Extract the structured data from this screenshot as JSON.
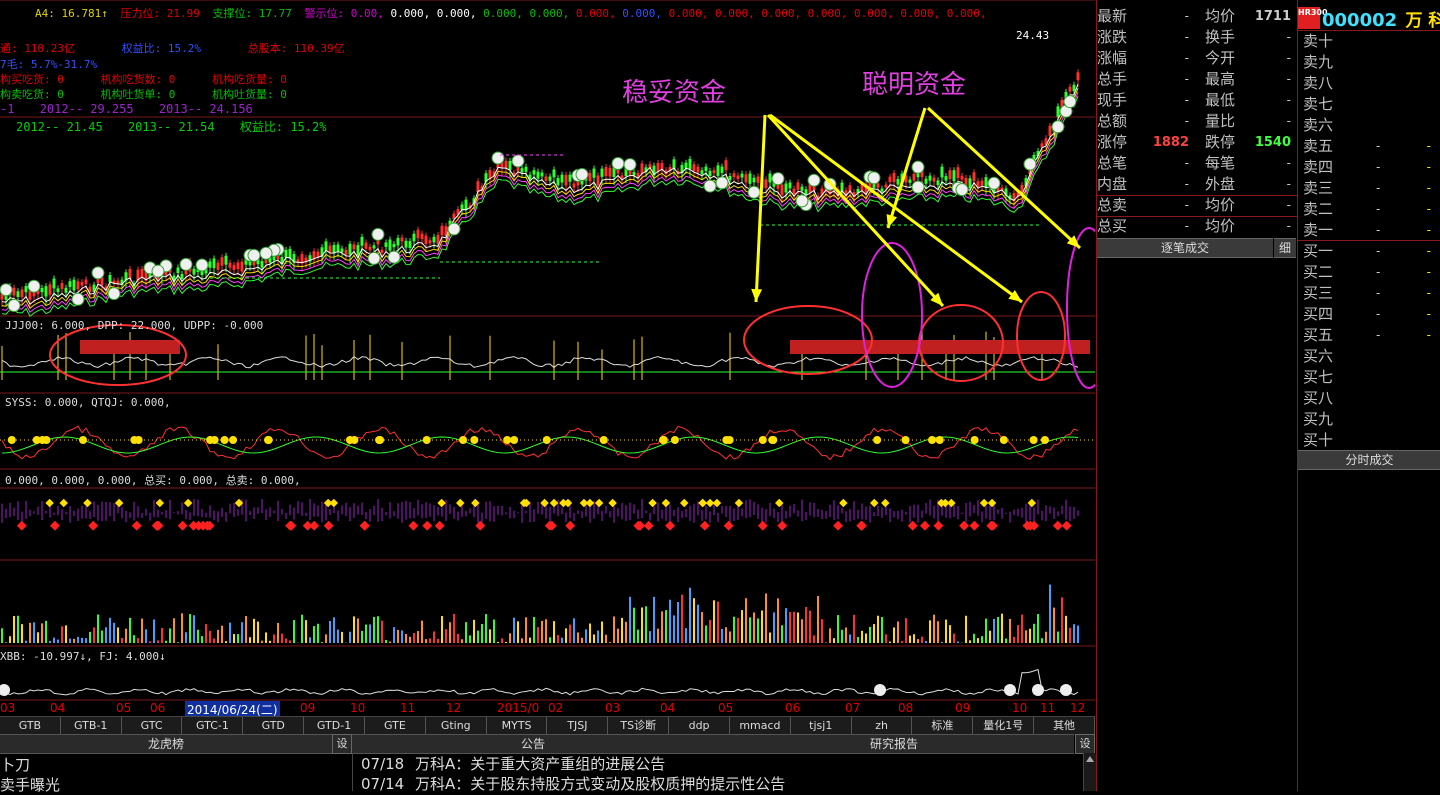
{
  "header": {
    "line1": {
      "ma": "A4: 16.781↑",
      "pressure": "压力位: 21.99",
      "support": "支撑位: 17.77",
      "warning": "警示位:",
      "values": [
        "0.00",
        "0.000",
        "0.000",
        "0.000",
        "0.000",
        "0.000",
        "0.000",
        "0.000",
        "0.000",
        "0.000",
        "0.000",
        "0.000",
        "0.000",
        "0.000,"
      ]
    },
    "line2": {
      "circ": "通: 110.23亿",
      "equity_ratio": "权益比: 15.2%",
      "total_share": "总股本: 110.39亿"
    },
    "line3": "7毛: 5.7%-31.7%",
    "line4": {
      "a": "构买吃货: 0",
      "b": "机构吃货数: 0",
      "c": "机构吃货量: 0"
    },
    "line5": {
      "a": "构卖吃货: 0",
      "b": "机构吐货单: 0",
      "c": "机构吐货量: 0"
    },
    "line6": {
      "a": "-1",
      "b": "2012-- 29.255",
      "c": "2013-- 24.156"
    },
    "line7": {
      "a": "2012-- 21.45",
      "b": "2013-- 21.54",
      "c": "权益比: 15.2%"
    }
  },
  "annotations": {
    "stable": "稳妥资金",
    "smart": "聪明资金",
    "peak": "24.43"
  },
  "indicators": {
    "ind1": "JJJ00: 6.000, DPP: 22.000, UDPP: -0.000",
    "ind2": "SYSS: 0.000, QTQJ: 0.000,",
    "ind3": "0.000, 0.000, 0.000, 总买: 0.000, 总卖: 0.000,",
    "ind4": "XBB: -10.997↓, FJ: 4.000↓"
  },
  "date_axis": {
    "labels": [
      "03",
      "04",
      "05",
      "06",
      "2014/06/24(二)",
      "09",
      "10",
      "11",
      "12",
      "2015/0",
      "02",
      "03",
      "04",
      "05",
      "06",
      "07",
      "08",
      "09",
      "10",
      "11",
      "12"
    ]
  },
  "tabs": [
    "GTB",
    "GTB-1",
    "GTC",
    "GTC-1",
    "GTD",
    "GTD-1",
    "GTE",
    "Gting",
    "MYTS",
    "TJSJ",
    "TS诊断",
    "ddp",
    "mmacd",
    "tjsj1",
    "zh",
    "标准",
    "量化1号",
    "其他"
  ],
  "bottom": {
    "dragon_tiger": "龙虎榜",
    "announce": "公告",
    "research": "研究报告",
    "settings": "设",
    "left_lines": [
      "卜刀",
      "卖手曝光"
    ],
    "notices": [
      {
        "date": "07/18",
        "text": "万科A：关于重大资产重组的进展公告"
      },
      {
        "date": "07/14",
        "text": "万科A：关于股东持股方式变动及股权质押的提示性公告"
      }
    ]
  },
  "quote": {
    "rows": [
      {
        "l": "最新",
        "lv": "-",
        "r": "均价",
        "rv": "1711"
      },
      {
        "l": "涨跌",
        "lv": "-",
        "r": "换手",
        "rv": "-"
      },
      {
        "l": "涨幅",
        "lv": "-",
        "r": "今开",
        "rv": "-"
      },
      {
        "l": "总手",
        "lv": "-",
        "r": "最高",
        "rv": "-"
      },
      {
        "l": "现手",
        "lv": "-",
        "r": "最低",
        "rv": "-"
      },
      {
        "l": "总额",
        "lv": "-",
        "r": "量比",
        "rv": "-"
      },
      {
        "l": "涨停",
        "lv": "1882",
        "r": "跌停",
        "rv": "1540"
      },
      {
        "l": "总笔",
        "lv": "-",
        "r": "每笔",
        "rv": "-"
      },
      {
        "l": "内盘",
        "lv": "-",
        "r": "外盘",
        "rv": "-"
      },
      {
        "l": "总卖",
        "lv": "-",
        "r": "均价",
        "rv": "-"
      },
      {
        "l": "总买",
        "lv": "-",
        "r": "均价",
        "rv": "-"
      }
    ],
    "tick_btn": "逐笔成交",
    "detail_btn": "细"
  },
  "orderbook": {
    "logo": "HR300",
    "code": "000002",
    "name": "万 科A",
    "asks": [
      {
        "l": "卖十",
        "a": "",
        "b": ""
      },
      {
        "l": "卖九",
        "a": "",
        "b": ""
      },
      {
        "l": "卖八",
        "a": "",
        "b": ""
      },
      {
        "l": "卖七",
        "a": "",
        "b": ""
      },
      {
        "l": "卖六",
        "a": "",
        "b": ""
      },
      {
        "l": "卖五",
        "a": "-",
        "b": "-"
      },
      {
        "l": "卖四",
        "a": "-",
        "b": "-"
      },
      {
        "l": "卖三",
        "a": "-",
        "b": "-"
      },
      {
        "l": "卖二",
        "a": "-",
        "b": "-"
      },
      {
        "l": "卖一",
        "a": "-",
        "b": "-"
      }
    ],
    "bids": [
      {
        "l": "买一",
        "a": "-",
        "b": "-"
      },
      {
        "l": "买二",
        "a": "-",
        "b": "-"
      },
      {
        "l": "买三",
        "a": "-",
        "b": "-"
      },
      {
        "l": "买四",
        "a": "-",
        "b": "-"
      },
      {
        "l": "买五",
        "a": "-",
        "b": "-"
      },
      {
        "l": "买六",
        "a": "",
        "b": ""
      },
      {
        "l": "买七",
        "a": "",
        "b": ""
      },
      {
        "l": "买八",
        "a": "",
        "b": ""
      },
      {
        "l": "买九",
        "a": "",
        "b": ""
      },
      {
        "l": "买十",
        "a": "",
        "b": ""
      }
    ],
    "timeshare_btn": "分时成交"
  }
}
